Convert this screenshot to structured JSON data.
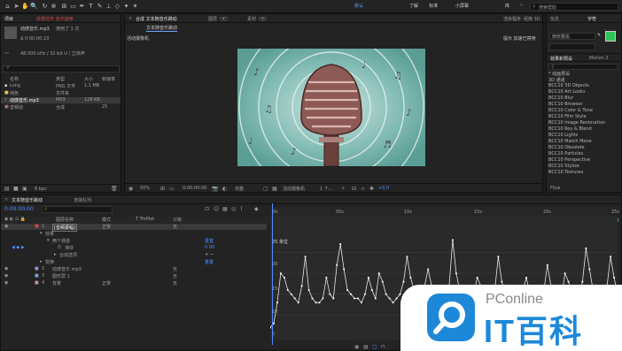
{
  "menubar": {
    "workspaces": [
      "默认",
      "了解",
      "标准",
      "小屏幕",
      "库"
    ],
    "search_placeholder": "搜索帮助"
  },
  "project_panel": {
    "tabs": [
      "项目",
      "效果控件 音乐旋律"
    ],
    "file_name": "动感音乐.mp3",
    "file_usage": "使用了 1 次",
    "duration": "Δ 0:00:00:23",
    "audio_info": "48.000 kHz / 32 bit U / 立体声",
    "columns": [
      "名称",
      "类型",
      "大小",
      "帧速率"
    ],
    "items": [
      {
        "name": "Long",
        "type": "PNG 文件",
        "size": "1.1 MB",
        "fps": ""
      },
      {
        "name": "纯色",
        "type": "文件夹",
        "size": "",
        "fps": ""
      },
      {
        "name": "动感音乐.mp3",
        "type": "MP3",
        "size": "128 KB",
        "fps": ""
      },
      {
        "name": "音频动",
        "type": "合成",
        "size": "",
        "fps": "25"
      }
    ],
    "bpc": "8 bpc"
  },
  "composition_panel": {
    "tabs": [
      "合成 文本随音乐跳动",
      "图层（无）",
      "素材（无）"
    ],
    "sub_tab": "文本随音乐跳动",
    "left_label": "活动摄像机",
    "right_labels": [
      "渲染程序",
      "经典 3D"
    ],
    "renderer_note": "提示 加速已禁用",
    "zoom": "50%",
    "timecode": "0:00:00:00",
    "resolution": "完整",
    "camera": "活动摄像机",
    "views": "1 个...",
    "exposure": "+0.0"
  },
  "right_panel": {
    "tabs": [
      "信息",
      "字符"
    ],
    "font": "微软雅黑",
    "accent_green": "#2fc15a",
    "effects_tabs": [
      "效果和预设",
      "Motion 2"
    ],
    "effects": [
      "* 动画预设",
      "3D 通道",
      "BCC10 3D Objects",
      "BCC10 Art Looks",
      "BCC10 Blur",
      "BCC10 Browser",
      "BCC10 Color & Tone",
      "BCC10 Film Style",
      "BCC10 Image Restoration",
      "BCC10 Key & Blend",
      "BCC10 Lights",
      "BCC10 Match Move",
      "BCC10 Obsolete",
      "BCC10 Particles",
      "BCC10 Perspective",
      "BCC10 Stylize",
      "BCC10 Textures"
    ],
    "flow_label": "Flow"
  },
  "timeline": {
    "tabs": [
      "文本随音乐跳动",
      "渲染队列"
    ],
    "timecode": "0:00:00:00",
    "columns": [
      "图层名称",
      "模式",
      "T TrkMat",
      "父级"
    ],
    "layers": [
      {
        "num": "1",
        "name": "[音频振幅]",
        "mode": "正常",
        "parent": "无"
      },
      {
        "name": "效果"
      },
      {
        "name": "两个通道"
      },
      {
        "name": "滑块",
        "value": "0.00"
      },
      {
        "name": "合成选项"
      },
      {
        "name": "变换",
        "value": "重置"
      },
      {
        "num": "2",
        "name": "动感音乐.mp3",
        "parent": "无"
      },
      {
        "num": "3",
        "name": "图形层 1",
        "parent": "无"
      },
      {
        "num": "4",
        "name": "背景",
        "mode": "正常",
        "parent": "无"
      }
    ],
    "reset_label": "重置",
    "ruler_labels": [
      "0s",
      "05s",
      "10s",
      "15s",
      "20s",
      "25s",
      "30s"
    ],
    "graph_label": "25 单位",
    "graph_ticks": [
      "20",
      "15",
      "10",
      "5"
    ],
    "amplitude": [
      2,
      3,
      8,
      15,
      14,
      11,
      10,
      9,
      8,
      12,
      19,
      11,
      9,
      8,
      8,
      9,
      14,
      10,
      9,
      17,
      22,
      16,
      11,
      10,
      9,
      9,
      8,
      10,
      14,
      11,
      9,
      15,
      13,
      10,
      9,
      8,
      9,
      10,
      13,
      19,
      14,
      11,
      9,
      8,
      12,
      16,
      12,
      9,
      8,
      9,
      10,
      12,
      23,
      15,
      11,
      10,
      9,
      8,
      10,
      14,
      12,
      10,
      9,
      9,
      11,
      19,
      13,
      10,
      8,
      9,
      10,
      9,
      11,
      14,
      10,
      9,
      8,
      9,
      11,
      17,
      12,
      9,
      8,
      9,
      15,
      13,
      10,
      9,
      9,
      13,
      21,
      16,
      11,
      10,
      9,
      8,
      12,
      19,
      14,
      10
    ]
  },
  "watermark": {
    "brand_top": "PConline",
    "brand_bottom": "IT百科",
    "brand_color": "#1d88d8"
  }
}
